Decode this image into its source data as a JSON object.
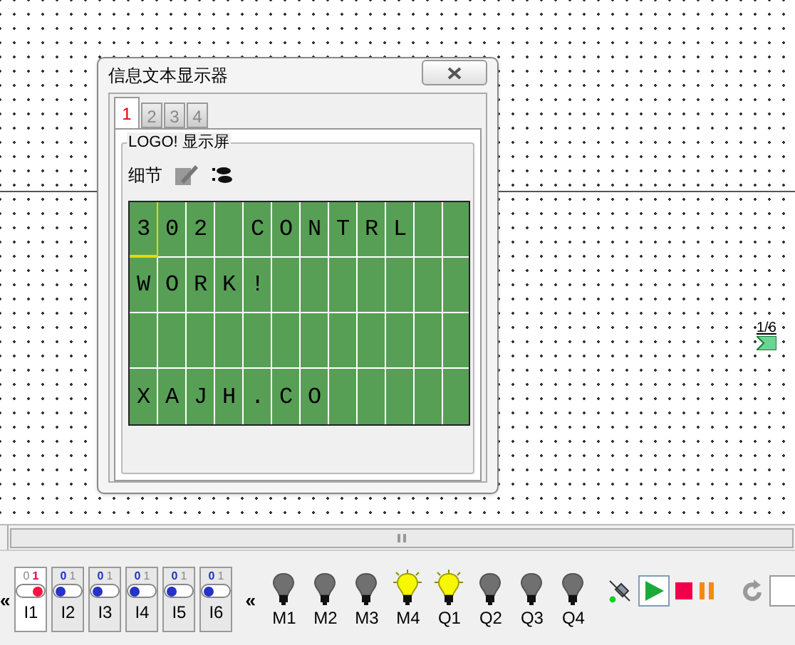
{
  "canvas": {
    "block_label": "1/6"
  },
  "dialog": {
    "title": "信息文本显示器",
    "tabs": [
      {
        "label": "1",
        "selected": true
      },
      {
        "label": "2",
        "selected": false
      },
      {
        "label": "3",
        "selected": false
      },
      {
        "label": "4",
        "selected": false
      }
    ],
    "group_title": "LOGO! 显示屏",
    "details_label": "细节",
    "lcd_rows": [
      {
        "text": "302 CONTRL",
        "cursor": true
      },
      {
        "text": "WORK!",
        "cursor": false
      },
      {
        "text": "",
        "cursor": false
      },
      {
        "text": "XAJH.CO",
        "cursor": false
      }
    ]
  },
  "toolbar": {
    "collapse_left": "«",
    "inputs": [
      {
        "label": "I1",
        "off_label": "0",
        "on_label": "1",
        "on": true
      },
      {
        "label": "I2",
        "off_label": "0",
        "on_label": "1",
        "on": false
      },
      {
        "label": "I3",
        "off_label": "0",
        "on_label": "1",
        "on": false
      },
      {
        "label": "I4",
        "off_label": "0",
        "on_label": "1",
        "on": false
      },
      {
        "label": "I5",
        "off_label": "0",
        "on_label": "1",
        "on": false
      },
      {
        "label": "I6",
        "off_label": "0",
        "on_label": "1",
        "on": false
      }
    ],
    "collapse_middle": "«",
    "lamps": [
      {
        "label": "M1",
        "on": false
      },
      {
        "label": "M2",
        "on": false
      },
      {
        "label": "M3",
        "on": false
      },
      {
        "label": "M4",
        "on": true
      },
      {
        "label": "Q1",
        "on": true
      },
      {
        "label": "Q2",
        "on": false
      },
      {
        "label": "Q3",
        "on": false
      },
      {
        "label": "Q4",
        "on": false
      }
    ],
    "run_selected": true
  }
}
